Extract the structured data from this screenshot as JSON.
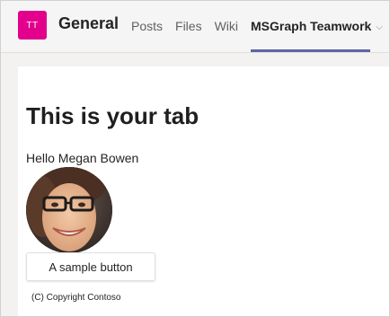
{
  "header": {
    "team_initials": "TT",
    "channel_name": "General",
    "tabs": [
      {
        "label": "Posts"
      },
      {
        "label": "Files"
      },
      {
        "label": "Wiki"
      },
      {
        "label": "MSGraph Teamwork"
      }
    ]
  },
  "content": {
    "heading": "This is your tab",
    "greeting": "Hello Megan Bowen",
    "photo_alt": "Megan Bowen",
    "button_label": "A sample button",
    "copyright": "(C) Copyright Contoso"
  },
  "colors": {
    "team_avatar": "#e3008c",
    "active_tab_underline": "#6264a7"
  }
}
